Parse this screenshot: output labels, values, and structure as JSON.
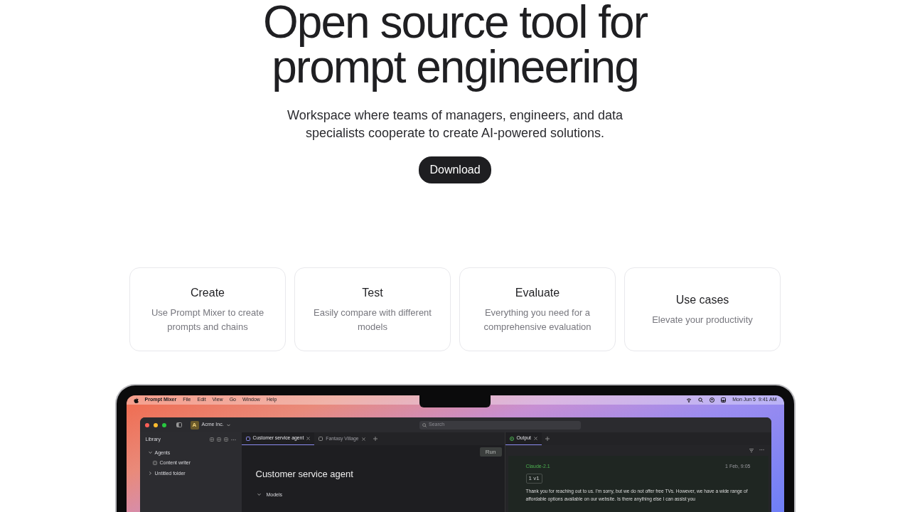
{
  "hero": {
    "title": "Open source tool for prompt engineering",
    "subtitle": "Workspace where teams of managers, engineers, and data specialists cooperate to create AI-powered solutions.",
    "button": "Download"
  },
  "features": [
    {
      "title": "Create",
      "text": "Use Prompt Mixer to create prompts and chains"
    },
    {
      "title": "Test",
      "text": "Easily compare with different models"
    },
    {
      "title": "Evaluate",
      "text": "Everything you need for a comprehensive evaluation"
    },
    {
      "title": "Use cases",
      "text": "Elevate your productivity"
    }
  ],
  "app": {
    "menu_bar": {
      "app_name": "Prompt Mixer",
      "menus": [
        "File",
        "Edit",
        "View",
        "Go",
        "Window",
        "Help"
      ],
      "clock": "Mon Jun 5  9:41 AM"
    },
    "window": {
      "workspace": {
        "avatar": "A",
        "name": "Acme Inc."
      },
      "search": {
        "placeholder": "Search"
      },
      "sidebar": {
        "title": "Library",
        "items": [
          {
            "kind": "folder",
            "label": "Agents",
            "expanded": true,
            "children": [
              {
                "kind": "document",
                "label": "Content writer"
              }
            ]
          },
          {
            "kind": "folder",
            "label": "Untitled folder",
            "expanded": false
          }
        ]
      },
      "tabs": [
        {
          "label": "Customer service agent",
          "selected": true
        },
        {
          "label": "Fantasy Village",
          "selected": false
        }
      ],
      "run_button": "Run",
      "document_title": "Customer service agent",
      "section": {
        "label": "Models",
        "expanded": true
      },
      "output_tabs": [
        {
          "label": "Output",
          "selected": true
        }
      ],
      "message": {
        "model": "Claude-2.1",
        "time": "1 Feb, 9:05",
        "version": "1 v1",
        "text": "Thank you for reaching out to us. I'm sorry, but we do not offer free TVs. However, we have a wide range of affordable options available on our website. Is there anything else I can assist you"
      }
    }
  }
}
